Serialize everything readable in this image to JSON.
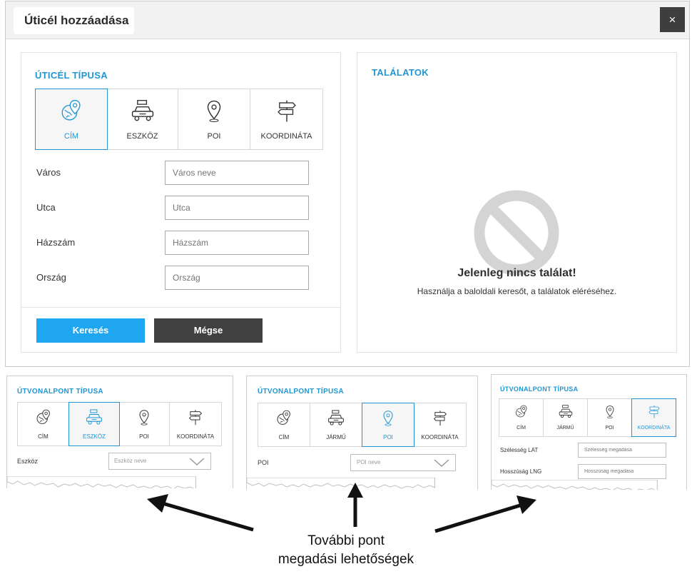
{
  "modal": {
    "title": "Úticél hozzáadása",
    "close_label": "×"
  },
  "destination_type": {
    "title": "ÚTICÉL TÍPUSA",
    "tabs": [
      {
        "label": "CÍM",
        "icon": "globe-pin-icon",
        "active": true
      },
      {
        "label": "ESZKÖZ",
        "icon": "car-icon",
        "active": false
      },
      {
        "label": "POI",
        "icon": "map-pin-icon",
        "active": false
      },
      {
        "label": "KOORDINÁTA",
        "icon": "signpost-icon",
        "active": false
      }
    ]
  },
  "address_form": {
    "fields": [
      {
        "label": "Város",
        "placeholder": "Város neve"
      },
      {
        "label": "Utca",
        "placeholder": "Utca"
      },
      {
        "label": "Házszám",
        "placeholder": "Házszám"
      },
      {
        "label": "Ország",
        "placeholder": "Ország"
      }
    ],
    "search_label": "Keresés",
    "cancel_label": "Mégse"
  },
  "results": {
    "title": "TALÁLATOK",
    "empty_title": "Jelenleg nincs találat!",
    "empty_text": "Használja a baloldali keresőt, a találatok eléréséhez."
  },
  "examples": [
    {
      "title": "ÚTVONALPONT TÍPUSA",
      "tabs": [
        "CÍM",
        "ESZKÖZ",
        "POI",
        "KOORDINÁTA"
      ],
      "active": 1,
      "field_label": "Eszköz",
      "field_placeholder": "Eszköz neve"
    },
    {
      "title": "ÚTVONALPONT TÍPUSA",
      "tabs": [
        "CÍM",
        "JÁRMŰ",
        "POI",
        "KOORDINÁTA"
      ],
      "active": 2,
      "field_label": "POI",
      "field_placeholder": "POI neve"
    },
    {
      "title": "ÚTVONALPONT TÍPUSA",
      "tabs": [
        "CÍM",
        "JÁRMŰ",
        "POI",
        "KOORDINÁTA"
      ],
      "active": 3,
      "lat_label": "Szélesség LAT",
      "lat_placeholder": "Szélesség megadása",
      "lng_label": "Hosszúság LNG",
      "lng_placeholder": "Hosszúság megadása"
    }
  ],
  "caption": {
    "line1": "További pont",
    "line2": "megadási lehetőségek"
  },
  "colors": {
    "accent": "#2196d3",
    "primary_button": "#1ea7f0",
    "dark_button": "#404040"
  }
}
